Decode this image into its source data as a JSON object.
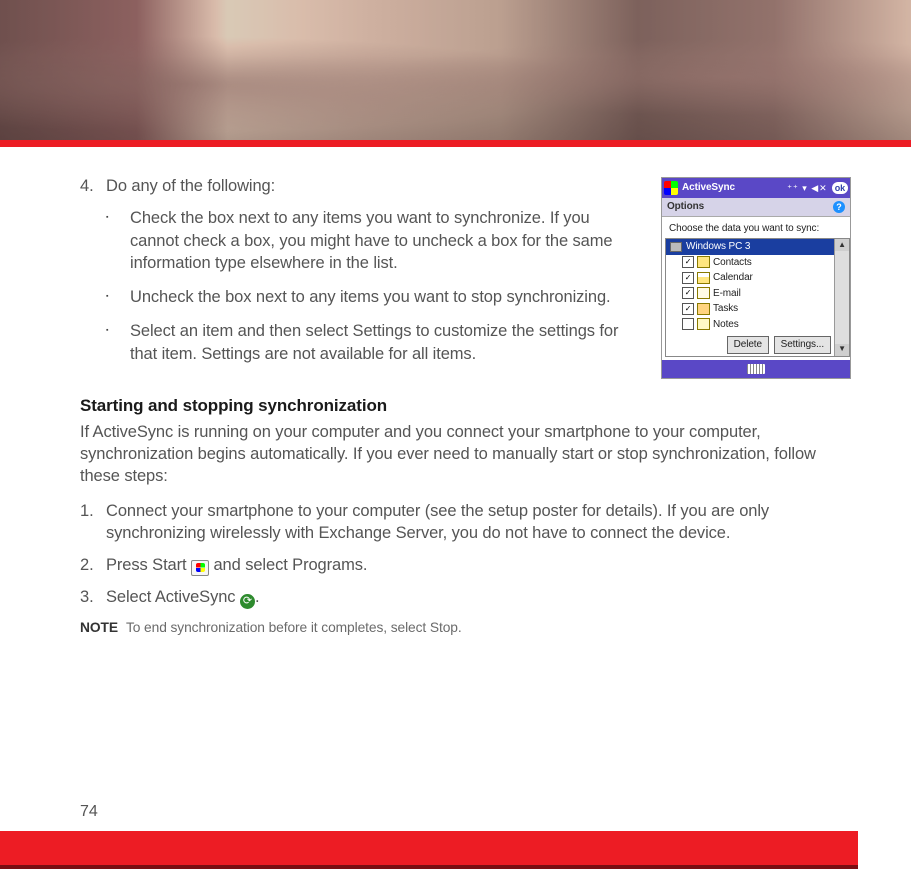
{
  "page_number": "74",
  "step4": {
    "num": "4.",
    "text": "Do any of the following:",
    "bullets": [
      "Check the box next to any items you want to synchronize. If you cannot check a box, you might have to uncheck a box for the same information type elsewhere in the list.",
      "Uncheck the box next to any items you want to stop synchronizing.",
      "Select an item and then select Settings to customize the settings for that item. Settings are not available for all items."
    ]
  },
  "screenshot": {
    "titlebar": "ActiveSync",
    "ok": "ok",
    "subbar": "Options",
    "instruction": "Choose the data you want to sync:",
    "root": "Windows PC 3",
    "items": [
      {
        "checked": true,
        "label": "Contacts"
      },
      {
        "checked": true,
        "label": "Calendar"
      },
      {
        "checked": true,
        "label": "E-mail"
      },
      {
        "checked": true,
        "label": "Tasks"
      },
      {
        "checked": false,
        "label": "Notes"
      }
    ],
    "btn_delete": "Delete",
    "btn_settings": "Settings..."
  },
  "section_heading": "Starting and stopping synchronization",
  "section_para": "If ActiveSync is running on your computer and you connect your smartphone to your computer, synchronization begins automatically. If you ever need to manually start or stop synchronization, follow these steps:",
  "steps": [
    {
      "num": "1.",
      "text": "Connect your smartphone to your computer (see the setup poster for details). If you are only synchronizing wirelessly with Exchange Server, you do not have to connect the device."
    },
    {
      "num": "2.",
      "pre": "Press Start ",
      "post": " and select Programs.",
      "icon": "start"
    },
    {
      "num": "3.",
      "pre": "Select ActiveSync ",
      "post": ".",
      "icon": "activesync"
    }
  ],
  "note": {
    "label": "NOTE",
    "text": "To end synchronization before it completes, select Stop."
  }
}
